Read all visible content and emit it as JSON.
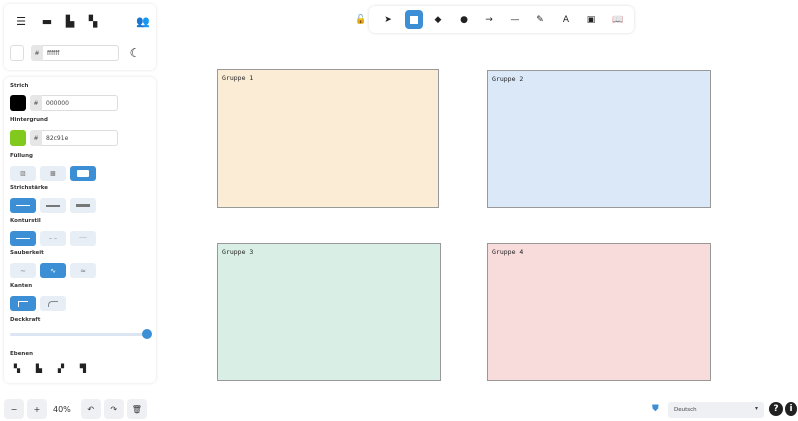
{
  "top_menu": {
    "color_hex": "ffffff",
    "hash": "#"
  },
  "properties": {
    "stroke": {
      "label": "Strich",
      "color": "#000000",
      "hex": "000000"
    },
    "background": {
      "label": "Hintergrund",
      "color": "#82c91e",
      "hex": "82c91e"
    },
    "fill": {
      "label": "Füllung"
    },
    "stroke_width": {
      "label": "Strichstärke"
    },
    "stroke_style": {
      "label": "Kontur­stil"
    },
    "sloppiness": {
      "label": "Sauberkeit"
    },
    "edges": {
      "label": "Kanten"
    },
    "opacity": {
      "label": "Deckkraft",
      "value": 100
    },
    "layers": {
      "label": "Ebenen"
    }
  },
  "canvas": {
    "groups": [
      {
        "label": "Gruppe 1",
        "color": "#fbedd5"
      },
      {
        "label": "Gruppe 2",
        "color": "#dae8f8"
      },
      {
        "label": "Gruppe 3",
        "color": "#d9efe6"
      },
      {
        "label": "Gruppe 4",
        "color": "#f8dbdb"
      }
    ]
  },
  "footer": {
    "zoom_out": "−",
    "zoom_in": "+",
    "zoom_level": "40%",
    "language": "Deutsch"
  },
  "colors": {
    "accent": "#3c8fd4"
  }
}
